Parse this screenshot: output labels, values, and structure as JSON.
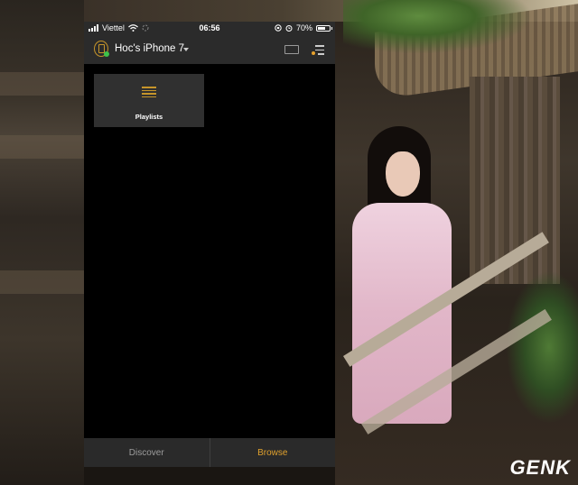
{
  "status_bar": {
    "carrier": "Viettel",
    "time": "06:56",
    "battery_percent": "70%",
    "battery_level": 0.7
  },
  "header": {
    "device_name": "Hoc's iPhone 7",
    "device_icon": "phone-ring-icon",
    "cast_icon": "cast-icon",
    "menu_icon": "queue-menu-icon"
  },
  "content": {
    "tiles": [
      {
        "label": "Playlists",
        "icon": "list-icon"
      }
    ]
  },
  "tab_bar": {
    "tabs": [
      {
        "label": "Discover",
        "active": false
      },
      {
        "label": "Browse",
        "active": true
      }
    ]
  },
  "watermark": {
    "text": "GENK"
  },
  "colors": {
    "accent": "#e0a12d",
    "connected": "#3cc24a",
    "bar_background": "#2b2b2b"
  }
}
